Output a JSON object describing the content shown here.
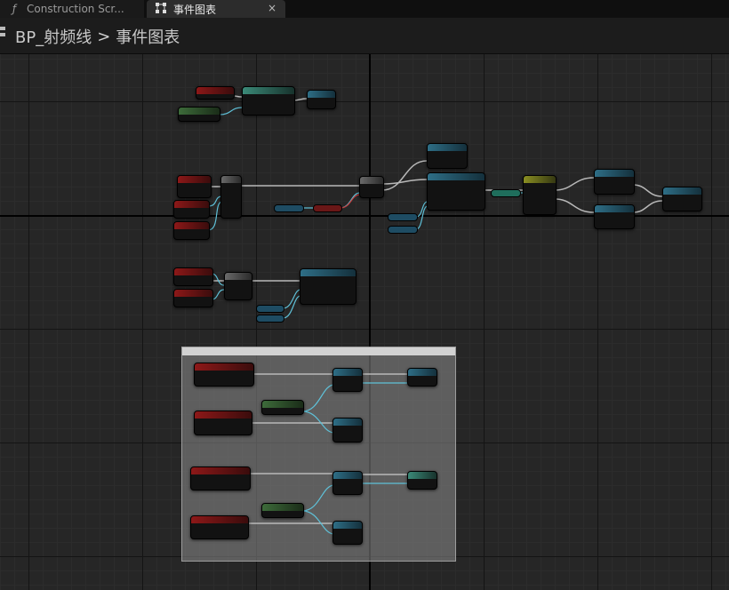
{
  "tabs": [
    {
      "label": "Construction Scr...",
      "icon": "function-icon",
      "active": false
    },
    {
      "label": "事件图表",
      "icon": "event-graph-icon",
      "active": true,
      "close": "×"
    }
  ],
  "breadcrumb": {
    "root": "BP_射频线",
    "separator": ">",
    "current": "事件图表"
  },
  "colors": {
    "event": "#8d1818",
    "function": "#2e6e86",
    "variable": "#3d6b3a",
    "exec_wire": "#b0b0b0",
    "data_wire": "#5fc1d8"
  }
}
